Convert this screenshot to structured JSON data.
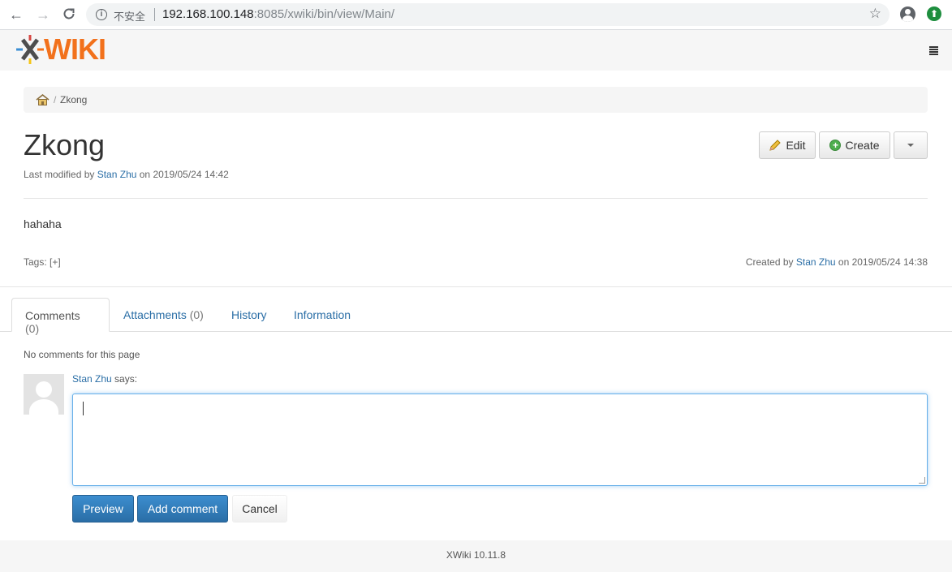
{
  "browser": {
    "insecure_label": "不安全",
    "url_host": "192.168.100.148",
    "url_rest": ":8085/xwiki/bin/view/Main/"
  },
  "header": {
    "logo_x": "X",
    "logo_text": "WIKI"
  },
  "breadcrumb": {
    "separator": "/",
    "current": "Zkong"
  },
  "page": {
    "title": "Zkong",
    "last_modified_prefix": "Last modified by ",
    "last_modified_user": "Stan Zhu",
    "last_modified_suffix": " on 2019/05/24 14:42",
    "content": "hahaha",
    "tags_label": "Tags: [+]",
    "created_prefix": "Created by ",
    "created_user": "Stan Zhu",
    "created_suffix": " on 2019/05/24 14:38"
  },
  "actions": {
    "edit": "Edit",
    "create": "Create"
  },
  "tabs": [
    {
      "label": "Comments",
      "count": "(0)"
    },
    {
      "label": "Attachments",
      "count": "(0)"
    },
    {
      "label": "History",
      "count": ""
    },
    {
      "label": "Information",
      "count": ""
    }
  ],
  "comments": {
    "empty_text": "No comments for this page",
    "author": "Stan Zhu",
    "says": " says:",
    "value": "",
    "preview": "Preview",
    "add": "Add comment",
    "cancel": "Cancel"
  },
  "footer": {
    "version": "XWiki 10.11.8"
  },
  "colors": {
    "link": "#2a6ea6",
    "logo_orange": "#f2711c",
    "primary": "#2a6ea6"
  }
}
